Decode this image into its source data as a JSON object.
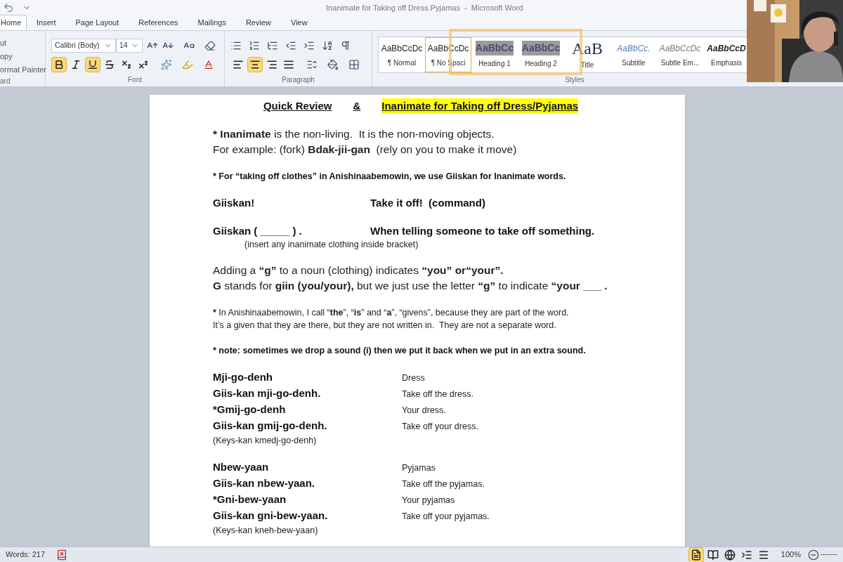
{
  "window": {
    "title": "Inanimate for Taking off Dress.Pyjamas  -  Microsoft Word"
  },
  "tabs": [
    {
      "label": "Home",
      "selected": true
    },
    {
      "label": "Insert",
      "selected": false
    },
    {
      "label": "Page Layout",
      "selected": false
    },
    {
      "label": "References",
      "selected": false
    },
    {
      "label": "Mailings",
      "selected": false
    },
    {
      "label": "Review",
      "selected": false
    },
    {
      "label": "View",
      "selected": false
    }
  ],
  "clipboard": {
    "items": [
      "ut",
      "opy",
      "ormat Painter"
    ],
    "label": "ard"
  },
  "font": {
    "name": "Calibri (Body)",
    "size": "14",
    "label": "Font",
    "format_buttons": [
      {
        "kind": "bold",
        "selected": true
      },
      {
        "kind": "italic",
        "selected": false
      },
      {
        "kind": "underline",
        "selected": true
      },
      {
        "kind": "strike",
        "selected": false
      },
      {
        "kind": "subscript",
        "selected": false
      },
      {
        "kind": "superscript",
        "selected": false
      }
    ]
  },
  "paragraph": {
    "label": "Paragraph",
    "align_buttons": [
      {
        "kind": "left",
        "selected": false
      },
      {
        "kind": "center",
        "selected": true
      },
      {
        "kind": "right",
        "selected": false
      },
      {
        "kind": "justify",
        "selected": false
      }
    ]
  },
  "styles": {
    "label": "Styles",
    "items": [
      {
        "kind": "normal",
        "preview": "AaBbCcDc",
        "name": "¶ Normal",
        "selected": false
      },
      {
        "kind": "normal",
        "preview": "AaBbCcDc",
        "name": "¶ No Spaci",
        "selected": true
      },
      {
        "kind": "heading",
        "preview": "AaBbCc",
        "name": "Heading 1",
        "selected": false
      },
      {
        "kind": "heading",
        "preview": "AaBbCc",
        "name": "Heading 2",
        "selected": false
      },
      {
        "kind": "title",
        "preview": "AaB",
        "name": "Title",
        "selected": false
      },
      {
        "kind": "subtitle",
        "preview": "AaBbCc.",
        "name": "Subtitle",
        "selected": false
      },
      {
        "kind": "subtle",
        "preview": "AaBbCcDc",
        "name": "Subtle Em...",
        "selected": false
      },
      {
        "kind": "emphasis",
        "preview": "AaBbCcD",
        "name": "Emphasis",
        "selected": false
      }
    ]
  },
  "document": {
    "title_left": "Quick Review",
    "title_mid": "&",
    "title_right": "Inanimate for Taking off Dress/Pyjamas",
    "groups": [
      [
        {
          "kind": "large",
          "bullet": "*",
          "text": "**Inanimate** is the non-living.  It is the non-moving objects."
        },
        {
          "kind": "large",
          "text": "For example: (fork) **Bdak-jii-gan**  (rely on you to make it move)"
        }
      ],
      [
        {
          "kind": "small-bold",
          "bullet": "*",
          "text": "For “taking off clothes” in Anishinaabemowin, we use Giiskan for Inanimate words."
        }
      ],
      [
        {
          "kind": "pair",
          "left": "Giiskan!",
          "right": "Take it off!  (command)"
        }
      ],
      [
        {
          "kind": "pair",
          "left": "Giiskan ( _____ ) .",
          "right": "When telling someone to take off something."
        },
        {
          "kind": "note",
          "text": "(insert any inanimate clothing inside bracket)"
        }
      ],
      [
        {
          "kind": "large",
          "text": "Adding a **“g”** to a noun (clothing) indicates **“you” or“your”.**"
        },
        {
          "kind": "large",
          "text": "**G** stands for **giin (you/your),** but we just use the letter **“g”** to indicate **“your ___ .**"
        }
      ],
      [
        {
          "kind": "small",
          "bullet": "*",
          "text": "In Anishinaabemowin, I call “**the**”, “**is**” and “**a**”, “givens”, because they are part of the word."
        },
        {
          "kind": "small",
          "text": "It’s a given that they are there, but they are not written in.  They are not a separate word."
        }
      ],
      [
        {
          "kind": "small-bold",
          "bullet": "*",
          "text": "note: sometimes we drop a sound (i) then we put it back when we put in an extra sound."
        }
      ],
      [
        {
          "kind": "vocab",
          "left": "Mji-go-denh",
          "right": "Dress"
        },
        {
          "kind": "vocab",
          "left": "Giis-kan mji-go-denh.",
          "right": "Take off the dress."
        },
        {
          "kind": "vocab",
          "left": "*Gmij-go-denh",
          "right": "Your dress."
        },
        {
          "kind": "vocab",
          "left": "Giis-kan gmij-go-denh.",
          "right": "Take off your dress."
        },
        {
          "kind": "aside",
          "text": "(Keys-kan kmedj-go-denh)"
        }
      ],
      [
        {
          "kind": "vocab",
          "left": "Nbew-yaan",
          "right": "Pyjamas"
        },
        {
          "kind": "vocab",
          "left": "Giis-kan nbew-yaan.",
          "right": "Take off the pyjamas."
        },
        {
          "kind": "vocab",
          "left": "*Gni-bew-yaan",
          "right": "Your pyjamas"
        },
        {
          "kind": "vocab",
          "left": "Giis-kan gni-bew-yaan.",
          "right": "Take off your pyjamas."
        },
        {
          "kind": "aside",
          "text": "(Keys-kan kneh-bew-yaan)"
        }
      ]
    ]
  },
  "status_bar": {
    "words": "Words: 217",
    "zoom": "100%",
    "view_buttons": [
      {
        "kind": "print",
        "selected": true
      },
      {
        "kind": "reading",
        "selected": false
      },
      {
        "kind": "web",
        "selected": false
      },
      {
        "kind": "outline",
        "selected": false
      },
      {
        "kind": "draft",
        "selected": false
      }
    ]
  }
}
